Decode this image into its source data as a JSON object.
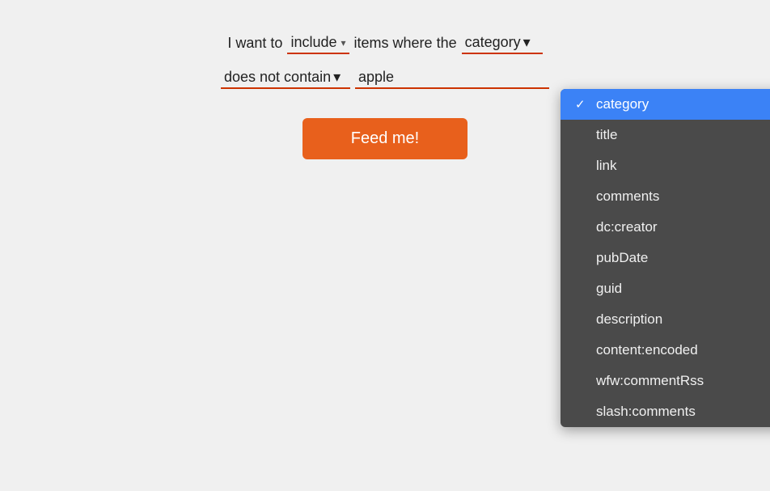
{
  "filter": {
    "intro_text": "I want to",
    "include_label": "include",
    "items_where_text": "items where the",
    "include_caret": "▾",
    "field": {
      "selected": "category",
      "caret": "▾"
    },
    "condition": {
      "selected": "does not contain",
      "caret": "▾"
    },
    "value": "apple"
  },
  "button": {
    "label": "Feed me!"
  },
  "dropdown": {
    "items": [
      {
        "value": "category",
        "selected": true
      },
      {
        "value": "title",
        "selected": false
      },
      {
        "value": "link",
        "selected": false
      },
      {
        "value": "comments",
        "selected": false
      },
      {
        "value": "dc:creator",
        "selected": false
      },
      {
        "value": "pubDate",
        "selected": false
      },
      {
        "value": "guid",
        "selected": false
      },
      {
        "value": "description",
        "selected": false
      },
      {
        "value": "content:encoded",
        "selected": false
      },
      {
        "value": "wfw:commentRss",
        "selected": false
      },
      {
        "value": "slash:comments",
        "selected": false
      }
    ]
  },
  "colors": {
    "accent": "#e8601c",
    "underline": "#cc3300",
    "dropdown_bg": "#4a4a4a",
    "selected_bg": "#3b82f6"
  }
}
